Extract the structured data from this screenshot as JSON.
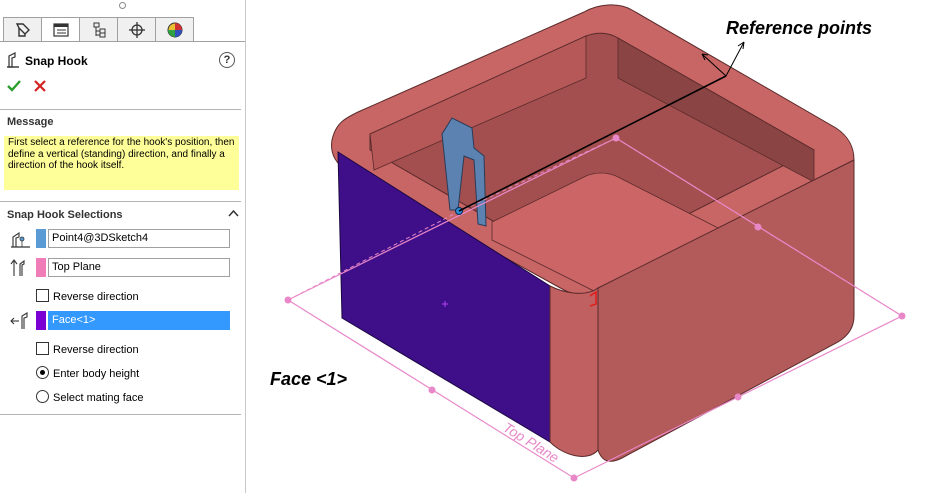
{
  "panel": {
    "tabs": [
      {
        "icon": "feature-manager-icon"
      },
      {
        "icon": "property-manager-icon"
      },
      {
        "icon": "configuration-manager-icon"
      },
      {
        "icon": "dimxpert-manager-icon"
      },
      {
        "icon": "display-manager-icon"
      }
    ],
    "title": "Snap Hook",
    "help_icon": "?",
    "message": {
      "header": "Message",
      "text": "First select a reference for the hook's position, then define a vertical (standing) direction, and finally a direction of the hook itself."
    },
    "selections": {
      "header": "Snap Hook Selections",
      "position_ref": {
        "value": "Point4@3DSketch4",
        "color": "#5b9bd5"
      },
      "vertical_ref": {
        "value": "Top Plane",
        "color": "#f07cb8"
      },
      "reverse_direction_1": "Reverse direction",
      "hook_direction": {
        "value": "Face<1>",
        "color": "#7a00d4"
      },
      "reverse_direction_2": "Reverse direction",
      "radio_body_height": "Enter body height",
      "radio_mating_face": "Select mating face",
      "selected_radio": "Enter body height"
    }
  },
  "viewport": {
    "annotation_points": "Reference points",
    "annotation_face": "Face <1>",
    "plane_label": "Top Plane",
    "colors": {
      "body": "#c76060",
      "body_dark": "#8e4545",
      "face_selected": "#3f0f8a",
      "plane": "#e888c8",
      "hook": "#4f78a8"
    }
  }
}
